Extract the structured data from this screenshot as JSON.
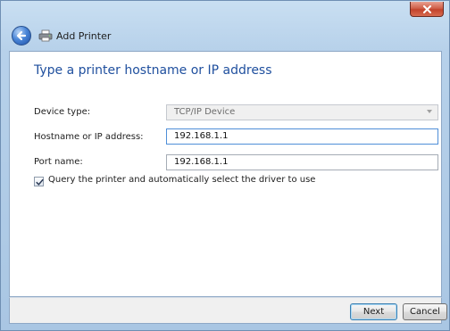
{
  "window": {
    "title": "Add Printer"
  },
  "content": {
    "heading": "Type a printer hostname or IP address",
    "device_type": {
      "label": "Device type:",
      "value": "TCP/IP Device"
    },
    "hostname": {
      "label": "Hostname or IP address:",
      "value": "192.168.1.1"
    },
    "port": {
      "label": "Port name:",
      "value": "192.168.1.1"
    },
    "query_driver": {
      "label": "Query the printer and automatically select the driver to use",
      "checked": true
    }
  },
  "buttons": {
    "next": "Next",
    "cancel": "Cancel"
  },
  "icons": {
    "close": "close-icon",
    "back": "back-arrow-icon",
    "printer": "printer-icon",
    "dropdown": "chevron-down-icon",
    "checkbox": "checkmark-icon"
  },
  "colors": {
    "heading": "#1f4f9e",
    "close_button": "#c2432c",
    "frame": "#b7d1ea"
  }
}
